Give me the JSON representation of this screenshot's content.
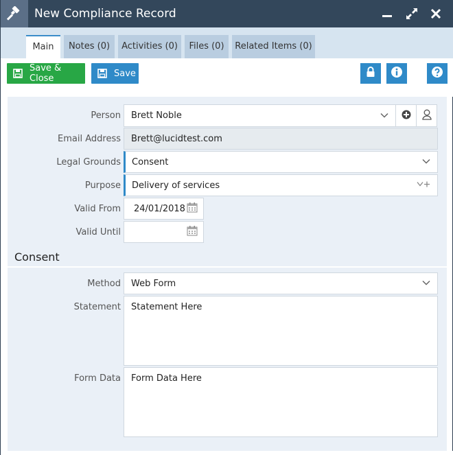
{
  "window": {
    "title": "New Compliance Record"
  },
  "tabs": [
    {
      "label": "Main"
    },
    {
      "label": "Notes (0)"
    },
    {
      "label": "Activities (0)"
    },
    {
      "label": "Files (0)"
    },
    {
      "label": "Related Items (0)"
    }
  ],
  "toolbar": {
    "save_close_label": "Save & Close",
    "save_label": "Save"
  },
  "form": {
    "person": {
      "label": "Person",
      "value": "Brett Noble"
    },
    "email": {
      "label": "Email Address",
      "value": "Brett@lucidtest.com"
    },
    "legal_grounds": {
      "label": "Legal Grounds",
      "value": "Consent"
    },
    "purpose": {
      "label": "Purpose",
      "value": "Delivery of services"
    },
    "valid_from": {
      "label": "Valid From",
      "value": "24/01/2018"
    },
    "valid_until": {
      "label": "Valid Until",
      "value": ""
    }
  },
  "consent": {
    "section_title": "Consent",
    "method": {
      "label": "Method",
      "value": "Web Form"
    },
    "statement": {
      "label": "Statement",
      "value": "Statement Here"
    },
    "form_data": {
      "label": "Form Data",
      "value": "Form Data Here"
    }
  },
  "colors": {
    "title_bar": "#33475b",
    "accent_blue": "#2f8ac8",
    "save_close_green": "#28a745",
    "panel_bg": "#eaf0f7"
  },
  "icons": [
    "gavel-icon",
    "minimize-icon",
    "maximize-icon",
    "close-icon",
    "save-icon",
    "lock-icon",
    "info-icon",
    "help-icon",
    "chevron-down-icon",
    "add-circle-icon",
    "person-icon",
    "calendar-icon",
    "chevron-plus-icon"
  ]
}
